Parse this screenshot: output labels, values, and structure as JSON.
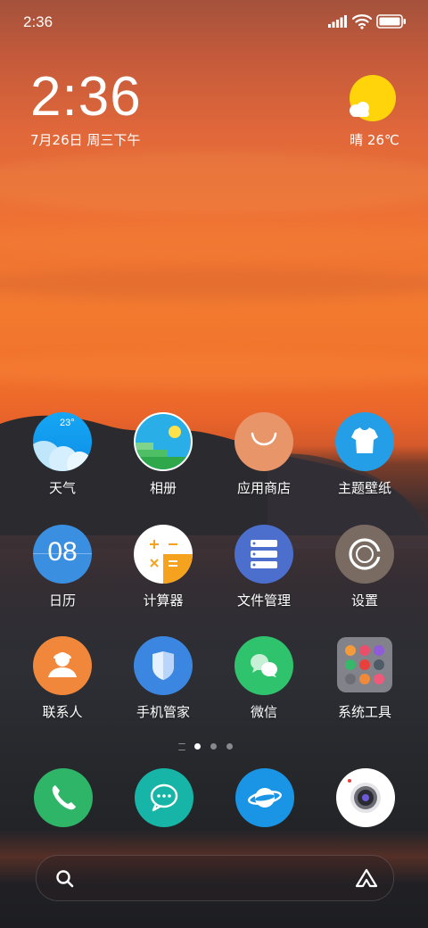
{
  "status_bar": {
    "time": "2:36",
    "icons": [
      "signal-icon",
      "wifi-icon",
      "battery-icon"
    ]
  },
  "clock_widget": {
    "time": "2:36",
    "date": "7月26日 周三下午"
  },
  "weather_widget": {
    "condition_icon": "sunny-icon",
    "text": "晴 26℃"
  },
  "apps": [
    {
      "label": "天气",
      "icon": "weather-app-icon",
      "badge_text": "23°",
      "color": "#1aa0f0"
    },
    {
      "label": "相册",
      "icon": "gallery-icon",
      "color": "#2ab0e8"
    },
    {
      "label": "应用商店",
      "icon": "app-store-icon",
      "color": "#e8956a"
    },
    {
      "label": "主题壁纸",
      "icon": "themes-icon",
      "color": "#2a9fe6"
    },
    {
      "label": "日历",
      "icon": "calendar-icon",
      "icon_text": "08",
      "color": "#3b8fe0"
    },
    {
      "label": "计算器",
      "icon": "calculator-icon",
      "color": "#f5a623"
    },
    {
      "label": "文件管理",
      "icon": "file-manager-icon",
      "color": "#4a6fd0"
    },
    {
      "label": "设置",
      "icon": "settings-icon",
      "color": "#7a6b62"
    },
    {
      "label": "联系人",
      "icon": "contacts-icon",
      "color": "#f0873a"
    },
    {
      "label": "手机管家",
      "icon": "security-icon",
      "color": "#3a86e0"
    },
    {
      "label": "微信",
      "icon": "wechat-icon",
      "color": "#2ec36c"
    },
    {
      "label": "系统工具",
      "icon": "folder-icon",
      "color": "#c8c8d2"
    }
  ],
  "pager": {
    "page_count": 3,
    "current_page": 1
  },
  "dock": [
    {
      "name": "phone",
      "icon": "phone-icon",
      "color": "#2fb567"
    },
    {
      "name": "messages",
      "icon": "messages-icon",
      "color": "#19b6a9"
    },
    {
      "name": "browser",
      "icon": "browser-icon",
      "color": "#1a95e6"
    },
    {
      "name": "camera",
      "icon": "camera-icon",
      "color": "#ffffff"
    }
  ],
  "search_bar": {
    "left_icon": "search-icon",
    "right_icon": "assistant-icon"
  }
}
